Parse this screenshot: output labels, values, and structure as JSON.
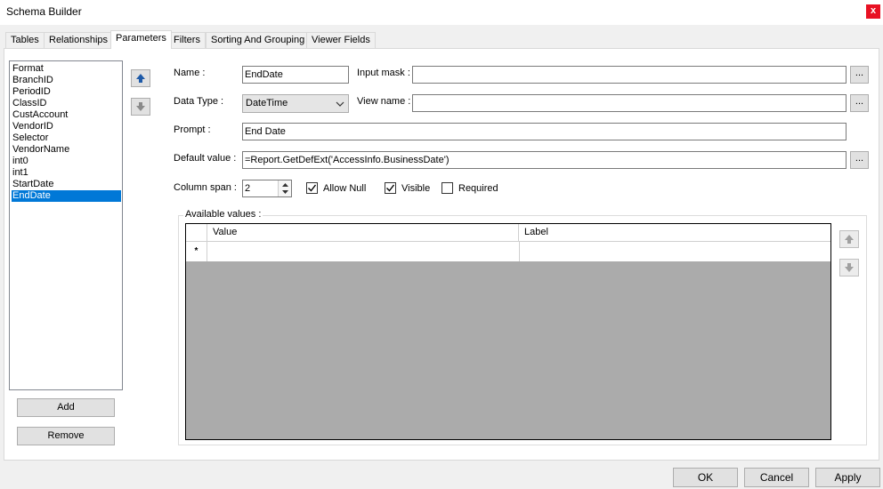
{
  "window": {
    "title": "Schema Builder",
    "close_label": "x"
  },
  "tabs": [
    {
      "label": "Tables"
    },
    {
      "label": "Relationships"
    },
    {
      "label": "Parameters"
    },
    {
      "label": "Filters"
    },
    {
      "label": "Sorting And Grouping"
    },
    {
      "label": "Viewer Fields"
    }
  ],
  "active_tab": "Parameters",
  "parameters_list": {
    "items": [
      "Format",
      "BranchID",
      "PeriodID",
      "ClassID",
      "CustAccount",
      "VendorID",
      "Selector",
      "VendorName",
      "int0",
      "int1",
      "StartDate",
      "EndDate"
    ],
    "selected": "EndDate",
    "add_label": "Add",
    "remove_label": "Remove"
  },
  "form": {
    "name_label": "Name :",
    "name_value": "EndDate",
    "input_mask_label": "Input mask :",
    "input_mask_value": "",
    "data_type_label": "Data Type :",
    "data_type_value": "DateTime",
    "view_name_label": "View name :",
    "view_name_value": "",
    "prompt_label": "Prompt :",
    "prompt_value": "End Date",
    "default_value_label": "Default value :",
    "default_value_value": "=Report.GetDefExt('AccessInfo.BusinessDate')",
    "column_span_label": "Column span :",
    "column_span_value": "2",
    "allow_null_label": "Allow Null",
    "allow_null_checked": true,
    "visible_label": "Visible",
    "visible_checked": true,
    "required_label": "Required",
    "required_checked": false,
    "ellipsis_label": "..."
  },
  "available_values": {
    "title": "Available values :",
    "columns": [
      "Value",
      "Label"
    ],
    "new_row_marker": "*"
  },
  "footer": {
    "ok_label": "OK",
    "cancel_label": "Cancel",
    "apply_label": "Apply"
  },
  "colors": {
    "selection": "#0078d7",
    "close": "#e81123",
    "grid_bg": "#ababab"
  }
}
